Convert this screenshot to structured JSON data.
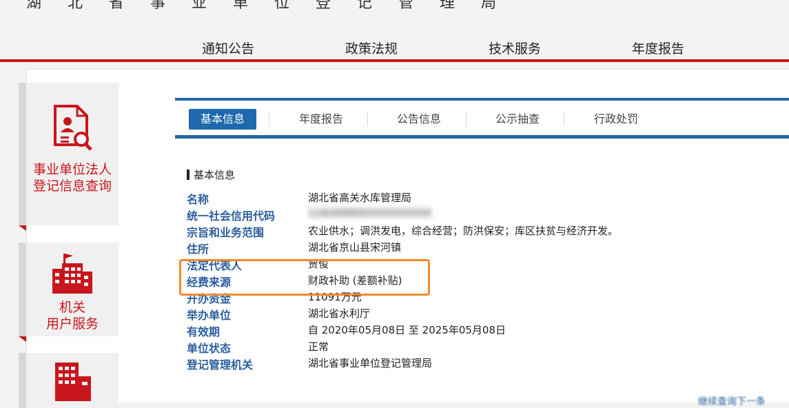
{
  "header": {
    "cut_text": "湖北省事业单位登记管理局"
  },
  "topnav": [
    {
      "label": "通知公告"
    },
    {
      "label": "政策法规"
    },
    {
      "label": "技术服务"
    },
    {
      "label": "年度报告"
    }
  ],
  "left_cards": [
    {
      "label_line1": "事业单位法人",
      "label_line2": "登记信息查询",
      "icon": "person-search-icon"
    },
    {
      "label_line1": "机关",
      "label_line2": "用户服务",
      "icon": "office-building-icon"
    },
    {
      "label_line1": "",
      "label_line2": "",
      "icon": "building-icon"
    }
  ],
  "tabs": [
    {
      "label": "基本信息",
      "active": true
    },
    {
      "label": "年度报告",
      "active": false
    },
    {
      "label": "公告信息",
      "active": false
    },
    {
      "label": "公示抽查",
      "active": false
    },
    {
      "label": "行政处罚",
      "active": false
    }
  ],
  "section_title": "基本信息",
  "info": [
    {
      "key": "名称",
      "value": "湖北省高关水库管理局"
    },
    {
      "key": "统一社会信用代码",
      "value": "12420000XXXXXXXXXX"
    },
    {
      "key": "宗旨和业务范围",
      "value": "农业供水；调洪发电，综合经营；防洪保安；库区扶贫与经济开发。"
    },
    {
      "key": "住所",
      "value": "湖北省京山县宋河镇"
    },
    {
      "key": "法定代表人",
      "value": "贾俊"
    },
    {
      "key": "经费来源",
      "value": "财政补助 (差额补贴)"
    },
    {
      "key": "开办资金",
      "value": "11091万元"
    },
    {
      "key": "举办单位",
      "value": "湖北省水利厅"
    },
    {
      "key": "有效期",
      "value": "自 2020年05月08日 至 2025年05月08日"
    },
    {
      "key": "单位状态",
      "value": "正常"
    },
    {
      "key": "登记管理机关",
      "value": "湖北省事业单位登记管理局"
    }
  ],
  "corner_text": "继续查询下一条",
  "colors": {
    "brand_red": "#c8161d",
    "tab_blue": "#1e68ad",
    "key_blue": "#2a5e9e",
    "highlight_orange": "#f28a2e"
  }
}
